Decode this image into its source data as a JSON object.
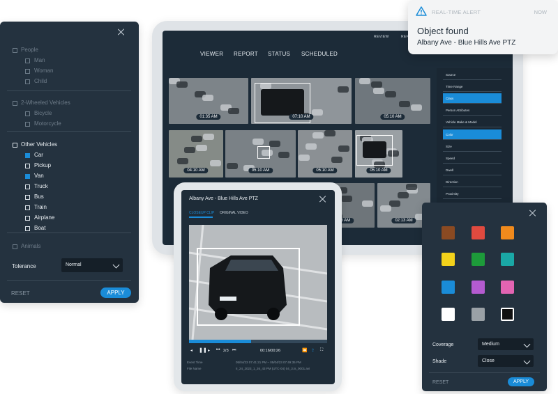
{
  "alert": {
    "kind": "REAL-TIME ALERT",
    "time": "NOW",
    "title": "Object found",
    "location": "Albany Ave - Blue Hills Ave PTZ"
  },
  "tablet": {
    "top_nav": [
      "REVIEW",
      "REP"
    ],
    "main_nav": [
      "VIEWER",
      "REPORT",
      "STATUS",
      "SCHEDULED"
    ],
    "thumb_times": [
      "01:35 AM",
      "07:10 AM",
      "05:10 AM",
      "04:10 AM",
      "05:10 AM",
      "05:10 AM",
      "05:10 AM",
      "01:25 AM",
      "02:13 AM"
    ],
    "sidebar": [
      "Source",
      "Time Range",
      "Class",
      "Person Attributes",
      "Vehicle Make & Model",
      "Color",
      "Size",
      "Speed",
      "Dwell",
      "Direction",
      "Proximity"
    ],
    "sidebar_active": [
      2,
      5
    ]
  },
  "filter": {
    "groups": [
      {
        "label": "People",
        "active": false,
        "items": [
          {
            "label": "Man",
            "checked": false
          },
          {
            "label": "Woman",
            "checked": false
          },
          {
            "label": "Child",
            "checked": false
          }
        ]
      },
      {
        "label": "2-Wheeled Vehicles",
        "active": false,
        "items": [
          {
            "label": "Bicycle",
            "checked": false
          },
          {
            "label": "Motorcycle",
            "checked": false
          }
        ]
      },
      {
        "label": "Other Vehicles",
        "active": true,
        "items": [
          {
            "label": "Car",
            "checked": true
          },
          {
            "label": "Pickup",
            "checked": false
          },
          {
            "label": "Van",
            "checked": true
          },
          {
            "label": "Truck",
            "checked": false
          },
          {
            "label": "Bus",
            "checked": false
          },
          {
            "label": "Train",
            "checked": false
          },
          {
            "label": "Airplane",
            "checked": false
          },
          {
            "label": "Boat",
            "checked": false
          }
        ]
      },
      {
        "label": "Animals",
        "active": false,
        "items": []
      }
    ],
    "tolerance_label": "Tolerance",
    "tolerance_value": "Normal",
    "reset": "RESET",
    "apply": "APPLY"
  },
  "player": {
    "title": "Albany Ave - Blue Hills Ave PTZ",
    "tabs": [
      "CLOSEUP CLIP",
      "ORIGINAL VIDEO"
    ],
    "progress": 0.45,
    "clip_index": "2/3",
    "timecode": "00:16/00:26",
    "meta": [
      {
        "label": "Event Time",
        "value": "05/04/23 07:41:21 PM  –  05/04/23 07:49:35 PM"
      },
      {
        "label": "File Name",
        "value": "II_24_2023_1_26_43 PM (UTC-04) 04_3.ts_0001.avi"
      }
    ]
  },
  "color_panel": {
    "colors": [
      "#8a4a22",
      "#e04a3f",
      "#f08a1c",
      "#f3d21b",
      "#1d9b3a",
      "#1aa8a6",
      "#1a8cd8",
      "#b45bd0",
      "#e264b2",
      "#ffffff",
      "#9aa1a6",
      "#111111"
    ],
    "selected_index": 11,
    "coverage_label": "Coverage",
    "coverage_value": "Medium",
    "shade_label": "Shade",
    "shade_value": "Close",
    "reset": "RESET",
    "apply": "APPLY"
  }
}
